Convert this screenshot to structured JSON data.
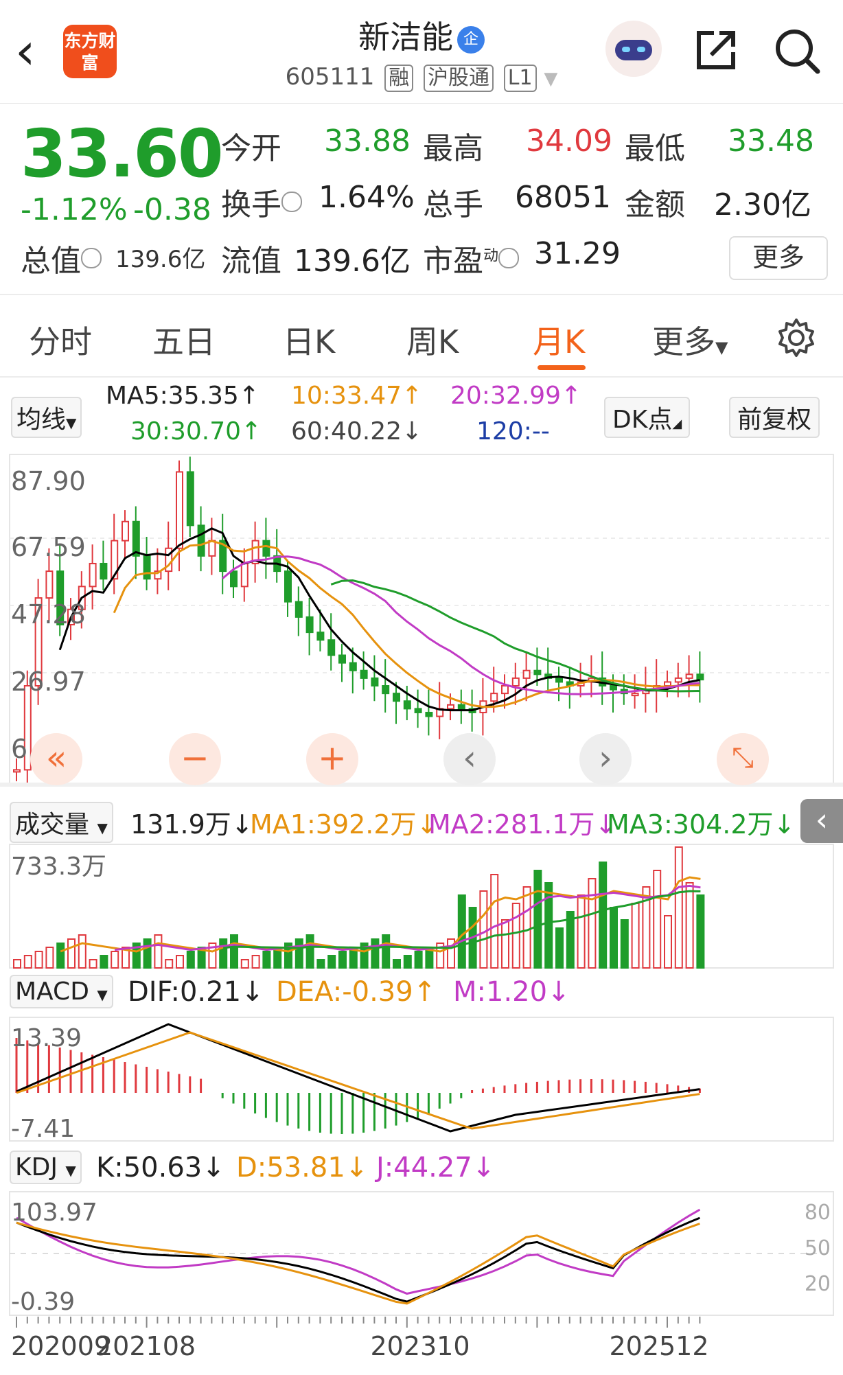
{
  "header": {
    "back_icon": "chevron-left-icon",
    "logo_text": "东方财富",
    "stock_name": "新洁能",
    "qi_badge": "企",
    "stock_code": "605111",
    "tags": [
      "融",
      "沪股通",
      "L1"
    ]
  },
  "quote": {
    "price": "33.60",
    "change_pct": "-1.12%",
    "change": "-0.38",
    "fields": {
      "open_label": "今开",
      "open": "33.88",
      "high_label": "最高",
      "high": "34.09",
      "low_label": "最低",
      "low": "33.48",
      "turnover_label": "换手",
      "turnover": "1.64%",
      "volume_label": "总手",
      "volume": "68051",
      "amount_label": "金额",
      "amount": "2.30亿",
      "mktcap_label": "总值",
      "mktcap": "139.6亿",
      "float_label": "流值",
      "float": "139.6亿",
      "pe_label": "市盈",
      "pe_sup": "动",
      "pe": "31.29"
    },
    "more_button": "更多"
  },
  "tabs": [
    "分时",
    "五日",
    "日K",
    "周K",
    "月K",
    "更多"
  ],
  "active_tab": "月K",
  "ma_row": {
    "selector": "均线",
    "ma5": "MA5:35.35↑",
    "ma10": "10:33.47↑",
    "ma20": "20:32.99↑",
    "ma30": "30:30.70↑",
    "ma60": "60:40.22↓",
    "ma120": "120:--",
    "dk_button": "DK点",
    "adjust_button": "前复权"
  },
  "price_axis": [
    "87.90",
    "67.59",
    "47.28",
    "26.97",
    "6.66"
  ],
  "volume_row": {
    "selector": "成交量",
    "value": "131.9万↓",
    "ma1": "MA1:392.2万↓",
    "ma2": "MA2:281.1万↓",
    "ma3": "MA3:304.2万↓",
    "axis_max": "733.3万"
  },
  "macd_row": {
    "selector": "MACD",
    "dif": "DIF:0.21↓",
    "dea": "DEA:-0.39↑",
    "m": "M:1.20↓",
    "axis_max": "13.39",
    "axis_min": "-7.41"
  },
  "kdj_row": {
    "selector": "KDJ",
    "k": "K:50.63↓",
    "d": "D:53.81↓",
    "j": "J:44.27↓",
    "axis_max": "103.97",
    "axis_min": "-0.39",
    "right_ticks": [
      "80",
      "50",
      "20"
    ]
  },
  "x_labels": [
    "202009",
    "202108",
    "202310",
    "202512"
  ],
  "colors": {
    "up": "#e0393e",
    "down": "#1f9d2b",
    "accent": "#f3621a",
    "ma5": "#000000",
    "ma10": "#e6920e",
    "ma20": "#c13bc5",
    "ma30": "#1f9d2b"
  }
}
